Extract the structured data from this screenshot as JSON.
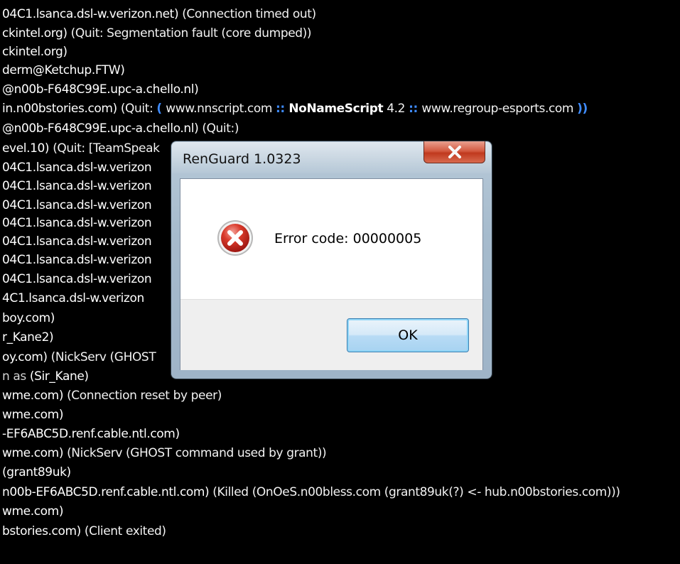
{
  "terminal": {
    "lines": [
      [
        [
          "04C1.lsanca.dsl-w.verizon.net) ",
          "a"
        ],
        [
          "(Connection timed out)",
          "c"
        ]
      ],
      [
        [
          "ckintel.org) ",
          "a"
        ],
        [
          "(Quit: Segmentation fault (core dumped))",
          "c"
        ]
      ],
      [
        [
          "ckintel.org)",
          "a"
        ]
      ],
      [
        [
          "derm@Ketchup.FTW)",
          "a"
        ]
      ],
      [
        [
          "@n00b-F648C99E.upc-a.chello.nl)",
          "a"
        ]
      ],
      [
        [
          "in.n00bstories.com) ",
          "a"
        ],
        [
          "(Quit: ",
          "c"
        ],
        [
          "( ",
          "d"
        ],
        [
          "www.nnscript.com ",
          "c"
        ],
        [
          ":: ",
          "d"
        ],
        [
          "NoNameScript",
          "e"
        ],
        [
          " 4.2 ",
          "c"
        ],
        [
          ":: ",
          "d"
        ],
        [
          "www.regroup-esports.com ",
          "c"
        ],
        [
          "))",
          "d"
        ]
      ],
      [
        [
          "@n00b-F648C99E.upc-a.chello.nl) ",
          "a"
        ],
        [
          "(Quit:)",
          "c"
        ]
      ],
      [
        [
          "evel.10) ",
          "a"
        ],
        [
          "(Quit: [TeamSpeak",
          "c"
        ]
      ],
      [
        [
          "04C1.lsanca.dsl-w.verizon",
          "a"
        ]
      ],
      [
        [
          "04C1.lsanca.dsl-w.verizon",
          "a"
        ]
      ],
      [
        [
          "04C1.lsanca.dsl-w.verizon",
          "a"
        ]
      ],
      [
        [
          "04C1.lsanca.dsl-w.verizon",
          "a"
        ]
      ],
      [
        [
          "04C1.lsanca.dsl-w.verizon",
          "a"
        ]
      ],
      [
        [
          "04C1.lsanca.dsl-w.verizon",
          "a"
        ]
      ],
      [
        [
          "04C1.lsanca.dsl-w.verizon",
          "a"
        ]
      ],
      [
        [
          "4C1.lsanca.dsl-w.verizon",
          "a"
        ]
      ],
      [
        [
          "boy.com)",
          "a"
        ]
      ],
      [
        [
          "r_Kane2)",
          "a"
        ]
      ],
      [
        [
          "oy.com) ",
          "a"
        ],
        [
          "(NickServ (GHOST",
          "c"
        ]
      ],
      [
        [
          "n as ",
          "b"
        ],
        [
          "(Sir_Kane)",
          "a"
        ]
      ],
      [
        [
          "wme.com) ",
          "a"
        ],
        [
          "(Connection reset by peer)",
          "c"
        ]
      ],
      [
        [
          "wme.com)",
          "a"
        ]
      ],
      [
        [
          "-EF6ABC5D.renf.cable.ntl.com)",
          "a"
        ]
      ],
      [
        [
          "wme.com) ",
          "a"
        ],
        [
          "(NickServ (GHOST command used by grant))",
          "c"
        ]
      ],
      [
        [
          "(grant89uk)",
          "a"
        ]
      ],
      [
        [
          "n00b-EF6ABC5D.renf.cable.ntl.com) ",
          "a"
        ],
        [
          "(Killed (OnOeS.n00bless.com (grant89uk(?) <- hub.n00bstories.com)))",
          "c"
        ]
      ],
      [
        [
          "wme.com)",
          "a"
        ]
      ],
      [
        [
          "bstories.com) ",
          "a"
        ],
        [
          "(Client exited)",
          "c"
        ]
      ]
    ]
  },
  "dialog": {
    "title": "RenGuard 1.0323",
    "message": "Error code: 00000005",
    "ok_label": "OK",
    "icon": "error-icon",
    "close_icon": "close-icon"
  }
}
